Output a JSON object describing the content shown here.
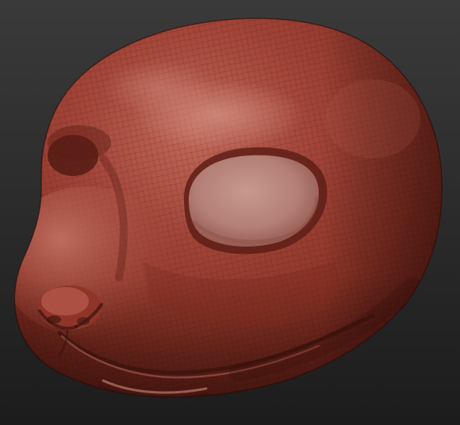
{
  "scene": {
    "subject": "head-sculpt",
    "colors": {
      "background_top": "#3a3a3a",
      "background_bottom": "#1c1c1c",
      "clay_highlight": "#c9857a",
      "clay_light": "#b25747",
      "clay_mid": "#94392b",
      "clay_dark": "#5e1f16",
      "clay_shadow": "#3b130d",
      "eye_socket": "#b87e75",
      "wireframe": "#2a0c08"
    }
  }
}
